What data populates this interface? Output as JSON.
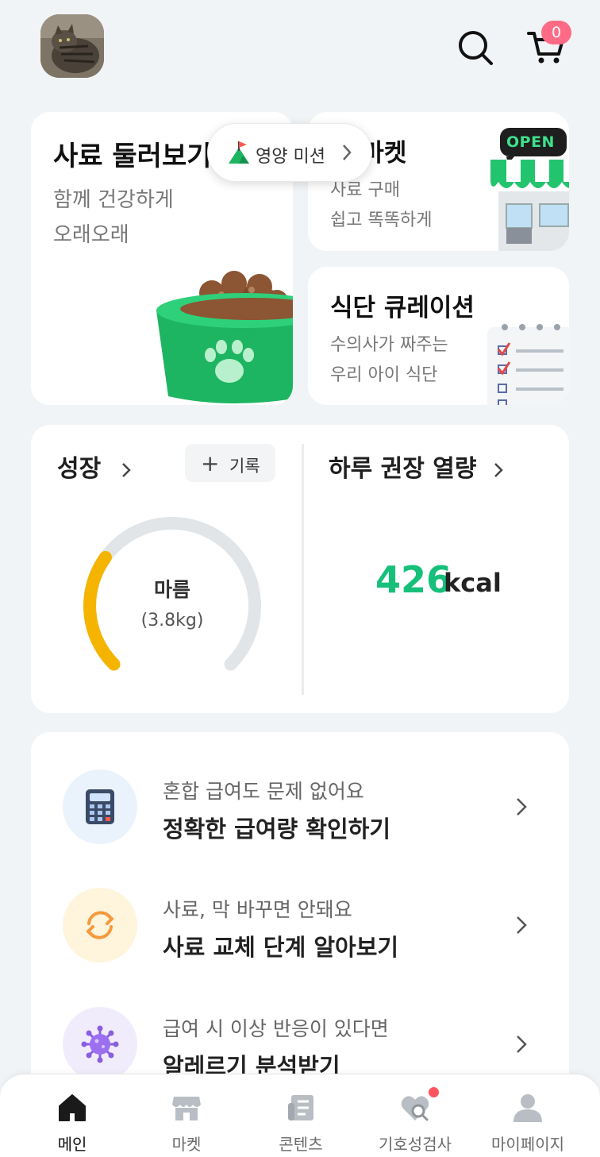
{
  "header": {
    "avatar": "cat-profile-photo",
    "cart_count": "0"
  },
  "cards": {
    "browse": {
      "title": "사료 둘러보기",
      "sub1": "함께 건강하게",
      "sub2": "오래오래"
    },
    "market": {
      "title": "펫 마켓",
      "sub1": "사료 구매",
      "sub2": "쉽고 똑똑하게",
      "sign": "OPEN"
    },
    "curation": {
      "title": "식단 큐레이션",
      "sub1": "수의사가 짜주는",
      "sub2": "우리 아이 식단"
    }
  },
  "mission": {
    "label": "영양 미션"
  },
  "growth": {
    "title": "성장",
    "record_label": "기록",
    "status": "마름",
    "weight": "(3.8kg)",
    "gauge_fill": 0.3
  },
  "calories": {
    "title": "하루 권장 열량",
    "value": "426",
    "unit": "kcal"
  },
  "tips": [
    {
      "sub": "혼합 급여도 문제 없어요",
      "main": "정확한 급여량 확인하기",
      "icon": "calculator-icon"
    },
    {
      "sub": "사료, 막 바꾸면 안돼요",
      "main": "사료 교체 단계 알아보기",
      "icon": "refresh-icon"
    },
    {
      "sub": "급여 시 이상 반응이 있다면",
      "main": "알레르기 분석받기",
      "icon": "virus-icon"
    }
  ],
  "nav": [
    {
      "label": "메인",
      "icon": "home-icon",
      "active": true
    },
    {
      "label": "마켓",
      "icon": "store-icon"
    },
    {
      "label": "콘텐츠",
      "icon": "document-icon"
    },
    {
      "label": "기호성검사",
      "icon": "heart-search-icon"
    },
    {
      "label": "마이페이지",
      "icon": "person-icon"
    }
  ],
  "colors": {
    "accent": "#16c07a",
    "gauge": "#f5b400",
    "badge": "#ff6b87"
  }
}
